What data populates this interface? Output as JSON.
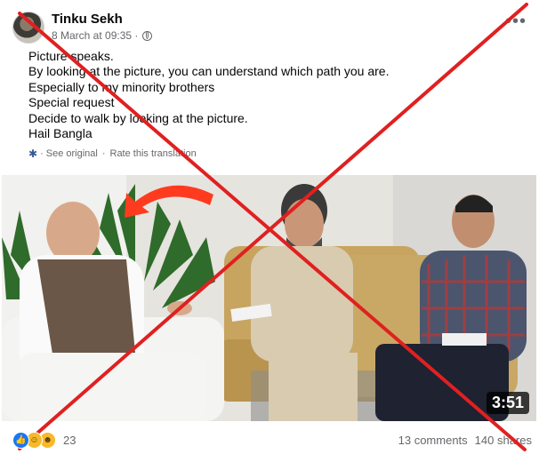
{
  "post": {
    "author": "Tinku Sekh",
    "timestamp": "8 March at 09:35 ·",
    "privacy_icon": "globe-icon",
    "more_icon": "more-options-icon",
    "text_lines": [
      "Picture speaks.",
      "By looking at the picture, you can understand which path you are.",
      "Especially to my minority brothers",
      "Special request",
      "Decide to walk by looking at the picture.",
      "Hail Bangla"
    ],
    "see_original": "See original",
    "rate_translation": "Rate this translation",
    "separator": "·"
  },
  "video": {
    "duration": "3:51"
  },
  "footer": {
    "reaction_count": "23",
    "comments": "13 comments",
    "shares": "140 shares",
    "reaction_icons": [
      "like-icon",
      "haha-icon",
      "care-icon"
    ]
  },
  "colors": {
    "cross": "#e02020",
    "arrow": "#ff3b1f",
    "meta_text": "#65676b",
    "link_blue": "#385898"
  }
}
